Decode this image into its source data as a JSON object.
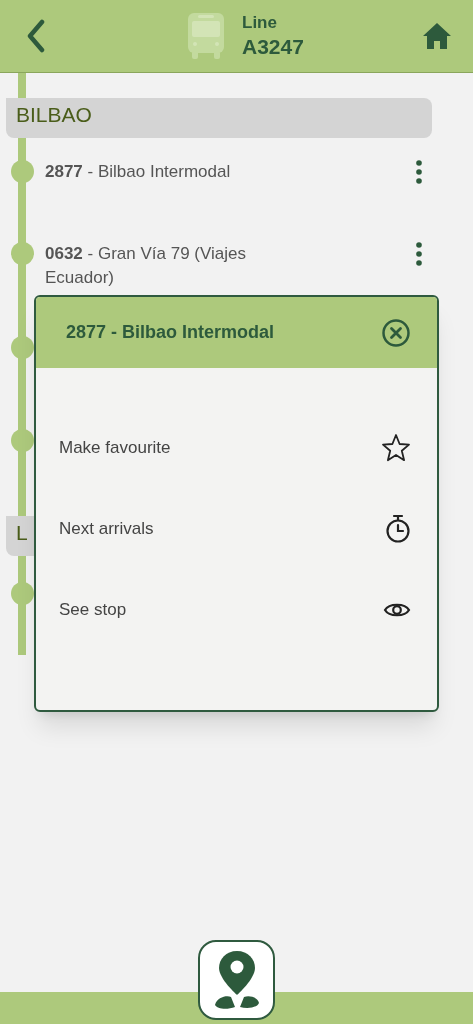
{
  "header": {
    "label": "Line",
    "line_code": "A3247"
  },
  "sections": [
    {
      "title": "BILBAO",
      "stops": [
        {
          "kind": "labelled",
          "label": "**2877** - Bilbao Intermodal"
        },
        {
          "kind": "labelled",
          "label": "**0632** - Gran Vía 79 (Viajes Ecuador)"
        },
        {
          "kind": "covered"
        },
        {
          "kind": "covered"
        }
      ]
    },
    {
      "title": "L",
      "stops": [
        {
          "kind": "covered"
        }
      ]
    }
  ],
  "popup": {
    "title": "2877 - Bilbao Intermodal",
    "actions": [
      {
        "label": "Make favourite",
        "kind": "favourite"
      },
      {
        "label": "Next arrivals",
        "kind": "arrivals"
      },
      {
        "label": "See stop",
        "kind": "view"
      }
    ]
  }
}
